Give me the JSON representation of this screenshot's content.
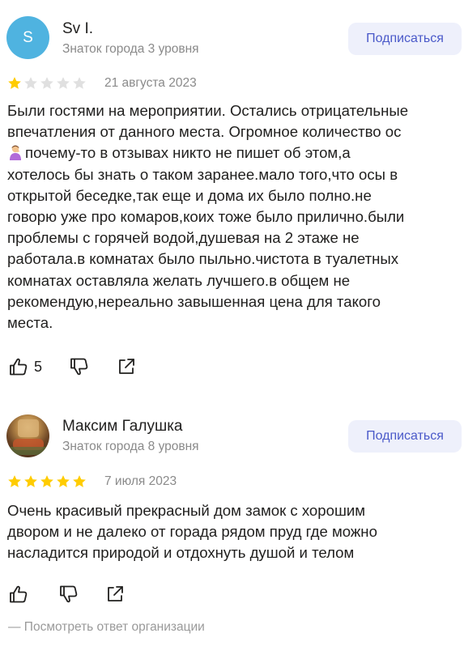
{
  "reviews": [
    {
      "avatar_letter": "S",
      "avatar_color": "#4fb3e0",
      "author": "Sv I.",
      "level": "Знаток города 3 уровня",
      "subscribe_label": "Подписаться",
      "rating": 1,
      "date": "21 августа 2023",
      "text_lines": [
        "Были гостями на мероприятии. Остались отрицательные",
        "впечатления от данного места. Огромное количество ос",
        "почему-то в отзывах никто не пишет об этом,а",
        "хотелось бы знать о таком заранее.мало того,что осы в",
        "открытой беседке,так еще и дома их было полно.не",
        "говорю уже про комаров,коих тоже было прилично.были",
        "проблемы с горячей водой,душевая на 2 этаже не",
        "работала.в комнатах было пыльно.чистота в туалетных",
        "комнатах оставляла желать лучшего.в общем не",
        "рекомендую,нереально завышенная цена для такого",
        "места."
      ],
      "emoji_icon": "person-facepalming-emoji",
      "likes": "5"
    },
    {
      "author": "Максим Галушка",
      "level": "Знаток города 8 уровня",
      "subscribe_label": "Подписаться",
      "rating": 5,
      "date": "7 июля 2023",
      "text_lines": [
        "Очень красивый прекрасный дом замок с хорошим",
        "двором и не далеко от горада рядом пруд где можно",
        "насладится природой и отдохнуть душой и телом"
      ],
      "org_reply_label": "— Посмотреть ответ организации"
    }
  ],
  "icons": {
    "like": "thumbs-up-icon",
    "dislike": "thumbs-down-icon",
    "share": "share-icon",
    "star": "star-icon"
  },
  "colors": {
    "star_filled": "#ffcc00",
    "star_empty": "#e0e0e0",
    "subscribe_bg": "#eef0fb",
    "subscribe_text": "#4a59c9",
    "muted_text": "#8a8a8a"
  }
}
